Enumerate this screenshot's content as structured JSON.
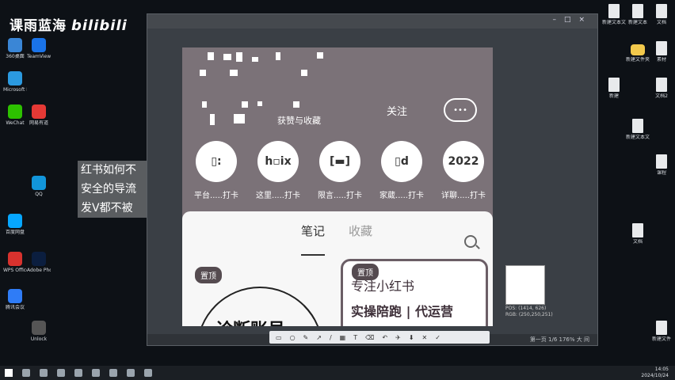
{
  "watermark": {
    "channel": "课雨蓝海",
    "logo": "bilibili"
  },
  "phone": {
    "follow_label": "关注",
    "stats_label": "获赞与收藏",
    "circles": [
      {
        "mark": "▯:",
        "label": "平台.....打卡"
      },
      {
        "mark": "h▫ix",
        "label": "这里.....打卡"
      },
      {
        "mark": "[▬]",
        "label": "限言.....打卡"
      },
      {
        "mark": "▯d",
        "label": "家葳.....打卡"
      },
      {
        "mark": "2022",
        "label": "详聊.....打卡"
      }
    ],
    "tabs": {
      "notes": "笔记",
      "collect": "收藏"
    },
    "pinned_label": "置顶",
    "card_left_text": "诊断账号",
    "card_right": {
      "line1": "专注小红书",
      "line2": "实操陪跑 | 代运营"
    }
  },
  "overlay_text": [
    "红书如何不",
    "安全的导流",
    "发V都不被"
  ],
  "viewer": {
    "status": "第一页 1/6  176%  大 间"
  },
  "zoom_info": [
    "POS: (1414, 626)",
    "RGB: (250,250,251)"
  ],
  "taskbar": {
    "time": "14:05",
    "date": "2024/10/24"
  },
  "desktop_left": [
    "360桌面",
    "TeamViewer",
    "Microsoft Edge",
    "WeChat",
    "网易有道",
    "QQ",
    "Adobe Photoshop",
    "百度网盘",
    "WPS Office",
    "腾讯会议",
    "Unlock"
  ],
  "desktop_right": [
    "新建文本文档",
    "新建文本",
    "文档",
    "新建文件夹",
    "素材",
    "新建",
    "文档2",
    "新建文本文档",
    "课程",
    "文档",
    "新建文件"
  ]
}
